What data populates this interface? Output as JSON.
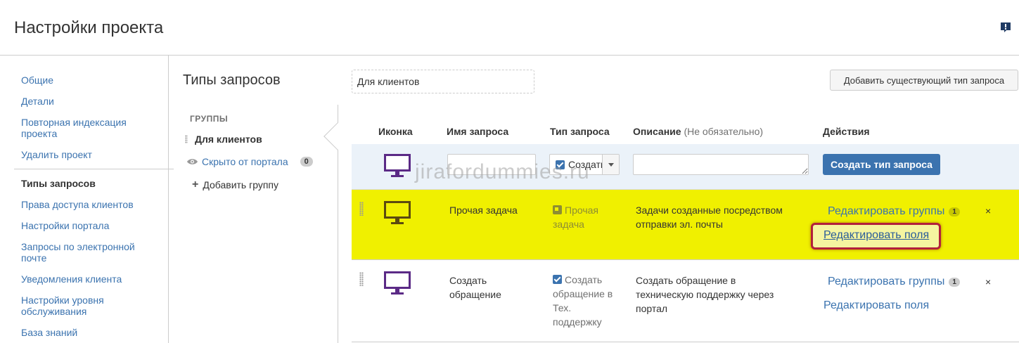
{
  "header": {
    "title": "Настройки проекта",
    "feedback_icon": "feedback-icon"
  },
  "sidebar": {
    "items": [
      {
        "label": "Общие",
        "active": false
      },
      {
        "label": "Детали",
        "active": false
      },
      {
        "label": "Повторная индексация проекта",
        "active": false
      },
      {
        "label": "Удалить проект",
        "active": false
      },
      {
        "label": "Типы запросов",
        "active": true
      },
      {
        "label": "Права доступа клиентов",
        "active": false
      },
      {
        "label": "Настройки портала",
        "active": false
      },
      {
        "label": "Запросы по электронной почте",
        "active": false
      },
      {
        "label": "Уведомления клиента",
        "active": false
      },
      {
        "label": "Настройки уровня обслуживания",
        "active": false
      },
      {
        "label": "База знаний",
        "active": false
      }
    ]
  },
  "section": {
    "title": "Типы запросов"
  },
  "groups": {
    "heading": "ГРУППЫ",
    "items": [
      {
        "label": "Для клиентов",
        "active": true
      },
      {
        "label": "Скрыто от портала",
        "count": "0"
      }
    ],
    "add_label": "Добавить группу"
  },
  "toolbar": {
    "group_name_value": "Для клиентов",
    "add_existing_label": "Добавить существующий тип запроса"
  },
  "table": {
    "headers": {
      "icon": "Иконка",
      "name": "Имя запроса",
      "type": "Тип запроса",
      "description": "Описание",
      "description_optional": "(Не обязательно)",
      "actions": "Действия"
    },
    "new_row": {
      "type_select_label": "Создать обращение",
      "create_button": "Создать тип запроса"
    },
    "rows": [
      {
        "name": "Прочая задача",
        "type": "Прочая задача",
        "description": "Задачи созданные посредством отправки эл. почты",
        "edit_groups": "Редактировать группы",
        "groups_count": "1",
        "edit_fields": "Редактировать поля",
        "highlighted": true
      },
      {
        "name": "Создать обращение",
        "type": "Создать обращение в Тех. поддержку",
        "description": "Создать обращение в техническую поддержку через портал",
        "edit_groups": "Редактировать группы",
        "groups_count": "1",
        "edit_fields": "Редактировать поля",
        "highlighted": false
      }
    ],
    "remove_symbol": "×"
  },
  "watermark": "jirafordummies.ru",
  "colors": {
    "link": "#3b73af",
    "highlight": "#f0f000",
    "monitor": "#5b2a86",
    "primary_button": "#3b73af",
    "callout": "#b2203b"
  }
}
